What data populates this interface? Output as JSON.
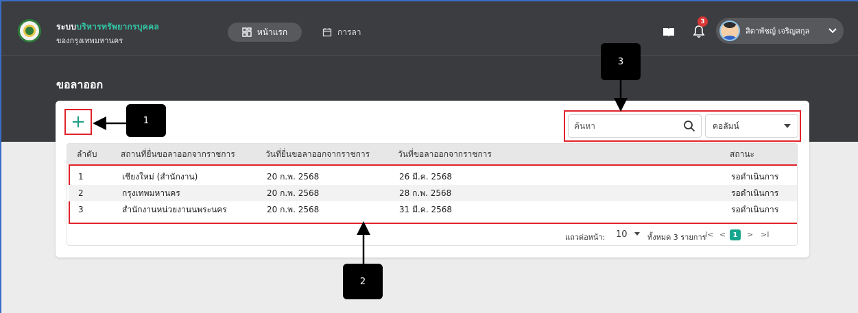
{
  "header": {
    "brand_prefix": "ระบบ",
    "brand_accent": "บริหารทรัพยากรบุคคล",
    "brand_sub": "ของกรุงเทพมหานคร",
    "nav_home_label": "หน้าแรก",
    "nav_leave_label": "การลา",
    "notification_count": "3",
    "user_name": "สิตาพัชญ์ เจริญสกุล"
  },
  "page": {
    "title": "ขอลาออก"
  },
  "toolbar": {
    "add_symbol": "+",
    "search_placeholder": "ค้นหา",
    "column_select_label": "คอลัมน์"
  },
  "table": {
    "headers": [
      "ลำดับ",
      "สถานที่ยื่นขอลาออกจากราชการ",
      "วันที่ยื่นขอลาออกจากราชการ",
      "วันที่ขอลาออกจากราชการ",
      "สถานะ"
    ],
    "rows": [
      [
        "1",
        "เชียงใหม่ (สำนักงาน)",
        "20 ก.พ. 2568",
        "26 มี.ค. 2568",
        "รอดำเนินการ"
      ],
      [
        "2",
        "กรุงเทพมหานคร",
        "20 ก.พ. 2568",
        "28 ก.พ. 2568",
        "รอดำเนินการ"
      ],
      [
        "3",
        "สำนักงานหน่วยงานนพระนคร",
        "20 ก.พ. 2568",
        "31 มี.ค. 2568",
        "รอดำเนินการ"
      ]
    ]
  },
  "pagination": {
    "rows_per_page_label": "แถวต่อหน้า:",
    "rows_per_page_value": "10",
    "total_label": "ทั้งหมด 3 รายการ",
    "first": "I<",
    "prev": "<",
    "current_page": "1",
    "next": ">",
    "last": ">I"
  },
  "callouts": {
    "one": "1",
    "two": "2",
    "three": "3"
  },
  "colors": {
    "accent_teal": "#17a58d",
    "highlight_red": "#e0232b",
    "badge_red": "#d93636",
    "header_dark": "#3c3d41"
  }
}
